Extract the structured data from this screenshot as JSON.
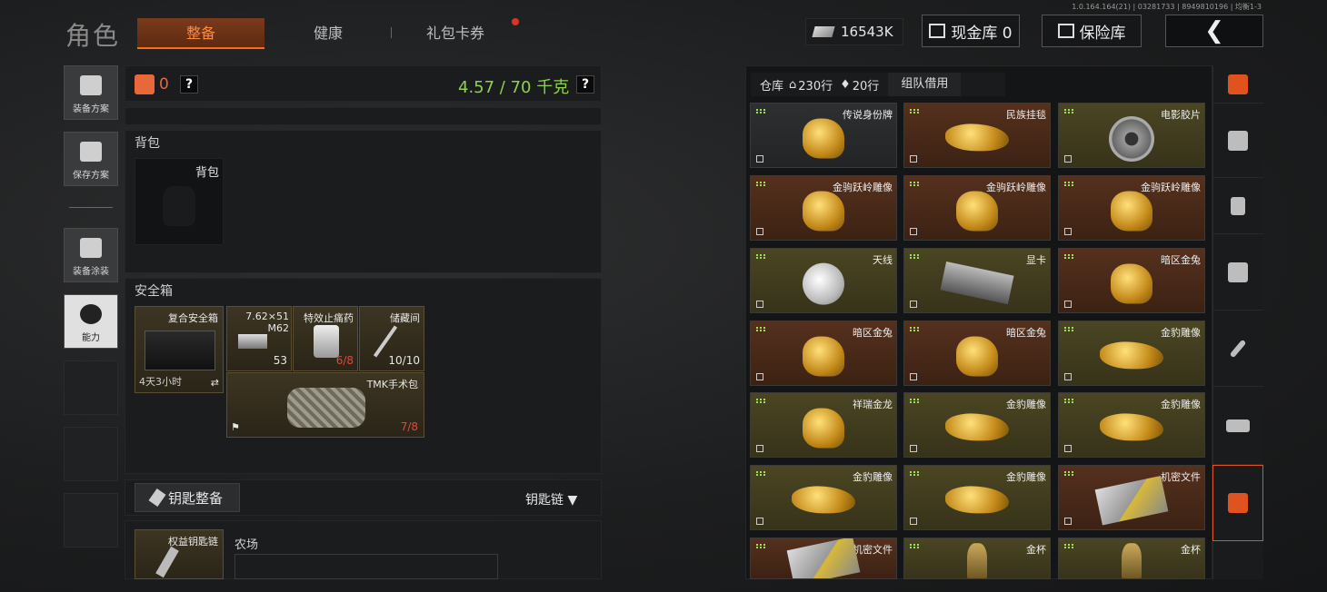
{
  "header": {
    "title": "角色",
    "tabs": [
      {
        "label": "整备",
        "active": true
      },
      {
        "label": "健康",
        "active": false
      },
      {
        "label": "礼包卡券",
        "active": false
      }
    ],
    "version": "1.0.164.164(21) | 03281733 | 8949810196 | 均衡1-3",
    "money": "16543K",
    "cash_vault_label": "现金库 0",
    "safe_label": "保险库",
    "back_icon": "chevron-left-icon"
  },
  "left_rail": [
    {
      "label": "装备方案",
      "icon": "vest-icon"
    },
    {
      "label": "保存方案",
      "icon": "download-icon"
    },
    {
      "label": "装备涂装",
      "icon": "helmet-icon"
    },
    {
      "label": "能力",
      "icon": "bolt-icon"
    }
  ],
  "loadout": {
    "bag_count": "0",
    "help": "?",
    "weight": "4.57 / 70 千克",
    "backpack_section": "背包",
    "backpack_slot": "背包",
    "safebox_section": "安全箱",
    "safebox": {
      "name": "复合安全箱",
      "timer": "4天3小时"
    },
    "ammo": {
      "name": "7.62×51 M62",
      "count": "53"
    },
    "medicine": {
      "name": "特效止痛药",
      "count": "6/8"
    },
    "key": {
      "name": "储藏间",
      "count": "10/10"
    },
    "surgery_kit": {
      "name": "TMK手术包",
      "count": "7/8"
    },
    "key_button": "钥匙整备",
    "keychain_label": "钥匙链",
    "keychain_slot": "权益钥匙链",
    "farm_label": "农场"
  },
  "warehouse": {
    "tab_label": "仓库",
    "rows": "230行",
    "extra": "20行",
    "team_tab": "组队借用",
    "items": [
      {
        "name": "传说身份牌",
        "bg": "dark",
        "art": "gold"
      },
      {
        "name": "民族挂毯",
        "bg": "brown",
        "art": "flat"
      },
      {
        "name": "电影胶片",
        "bg": "olive",
        "art": "reel"
      },
      {
        "name": "金驹跃岭雕像",
        "bg": "brown",
        "art": "gold"
      },
      {
        "name": "金驹跃岭雕像",
        "bg": "brown",
        "art": "gold"
      },
      {
        "name": "金驹跃岭雕像",
        "bg": "brown",
        "art": "gold"
      },
      {
        "name": "天线",
        "bg": "olive",
        "art": "dish"
      },
      {
        "name": "显卡",
        "bg": "olive",
        "art": "gpu"
      },
      {
        "name": "暗区金兔",
        "bg": "brown",
        "art": "gold"
      },
      {
        "name": "暗区金兔",
        "bg": "brown",
        "art": "gold"
      },
      {
        "name": "暗区金兔",
        "bg": "brown",
        "art": "gold"
      },
      {
        "name": "金豹雕像",
        "bg": "olive",
        "art": "flat"
      },
      {
        "name": "祥瑞金龙",
        "bg": "olive",
        "art": "gold"
      },
      {
        "name": "金豹雕像",
        "bg": "olive",
        "art": "flat"
      },
      {
        "name": "金豹雕像",
        "bg": "olive",
        "art": "flat"
      },
      {
        "name": "金豹雕像",
        "bg": "olive",
        "art": "flat"
      },
      {
        "name": "金豹雕像",
        "bg": "olive",
        "art": "flat"
      },
      {
        "name": "机密文件",
        "bg": "brown",
        "art": "disk"
      },
      {
        "name": "机密文件",
        "bg": "brown",
        "art": "disk"
      },
      {
        "name": "金杯",
        "bg": "olive",
        "art": "cup"
      },
      {
        "name": "金杯",
        "bg": "olive",
        "art": "cup"
      }
    ]
  },
  "colors": {
    "accent": "#e0531f",
    "weight_green": "#8fd14f",
    "alert_red": "#e0483a"
  }
}
